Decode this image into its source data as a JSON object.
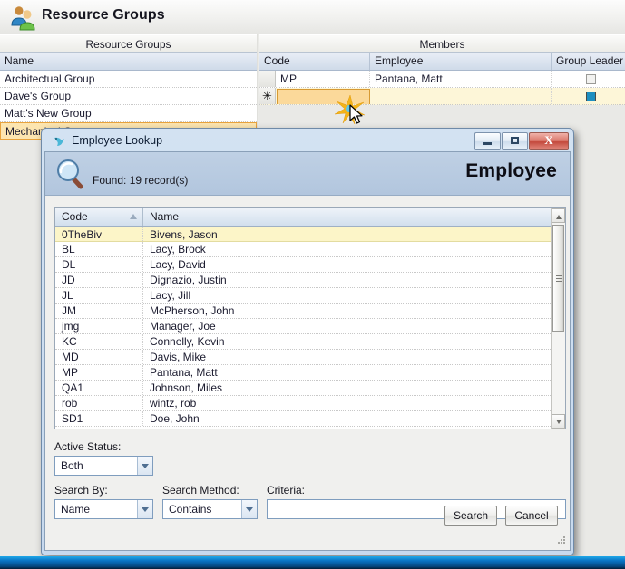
{
  "app": {
    "title": "Resource Groups",
    "icon": "people-icon"
  },
  "resource_groups_pane": {
    "title": "Resource Groups",
    "columns": [
      "Name"
    ],
    "rows": [
      {
        "name": "Architectual Group",
        "selected": false
      },
      {
        "name": "Dave's Group",
        "selected": false
      },
      {
        "name": "Matt's New Group",
        "selected": false
      },
      {
        "name": "Mechanical Group",
        "selected": true
      }
    ]
  },
  "members_pane": {
    "title": "Members",
    "columns": [
      "Code",
      "Employee",
      "Group Leader"
    ],
    "rows": [
      {
        "code": "MP",
        "employee": "Pantana, Matt",
        "group_leader": false,
        "new_row": false
      },
      {
        "code": "",
        "employee": "",
        "group_leader": true,
        "new_row": true,
        "marker": "✳"
      }
    ]
  },
  "dialog": {
    "title": "Employee Lookup",
    "title_icon": "bird-icon",
    "window_buttons": [
      {
        "name": "minimize-button",
        "glyph": "minimize"
      },
      {
        "name": "maximize-button",
        "glyph": "maximize"
      },
      {
        "name": "close-button",
        "glyph": "X"
      }
    ],
    "banner": {
      "icon": "magnifier-icon",
      "found_text": "Found: 19 record(s)",
      "heading": "Employee"
    },
    "table": {
      "columns": [
        "Code",
        "Name"
      ],
      "sort_column": "Code",
      "sort_direction": "ascending",
      "rows": [
        {
          "code": "0TheBiv",
          "name": "Bivens, Jason",
          "selected": true
        },
        {
          "code": "BL",
          "name": "Lacy, Brock",
          "selected": false
        },
        {
          "code": "DL",
          "name": "Lacy, David",
          "selected": false
        },
        {
          "code": "JD",
          "name": "Dignazio, Justin",
          "selected": false
        },
        {
          "code": "JL",
          "name": "Lacy, Jill",
          "selected": false
        },
        {
          "code": "JM",
          "name": "McPherson, John",
          "selected": false
        },
        {
          "code": "jmg",
          "name": "Manager, Joe",
          "selected": false
        },
        {
          "code": "KC",
          "name": "Connelly, Kevin",
          "selected": false
        },
        {
          "code": "MD",
          "name": "Davis, Mike",
          "selected": false
        },
        {
          "code": "MP",
          "name": "Pantana, Matt",
          "selected": false
        },
        {
          "code": "QA1",
          "name": "Johnson, Miles",
          "selected": false
        },
        {
          "code": "rob",
          "name": "wintz, rob",
          "selected": false
        },
        {
          "code": "SD1",
          "name": "Doe, John",
          "selected": false
        }
      ]
    },
    "form": {
      "active_status_label": "Active Status:",
      "active_status_value": "Both",
      "search_by_label": "Search By:",
      "search_by_value": "Name",
      "search_method_label": "Search Method:",
      "search_method_value": "Contains",
      "criteria_label": "Criteria:",
      "criteria_value": "",
      "criteria_placeholder": ""
    },
    "buttons": {
      "search": "Search",
      "cancel": "Cancel"
    }
  },
  "colors": {
    "accent_blue": "#1e8fc0",
    "selection_yellow": "#fcf5c8",
    "edit_orange": "#fbd99a",
    "close_red": "#c3483b"
  }
}
